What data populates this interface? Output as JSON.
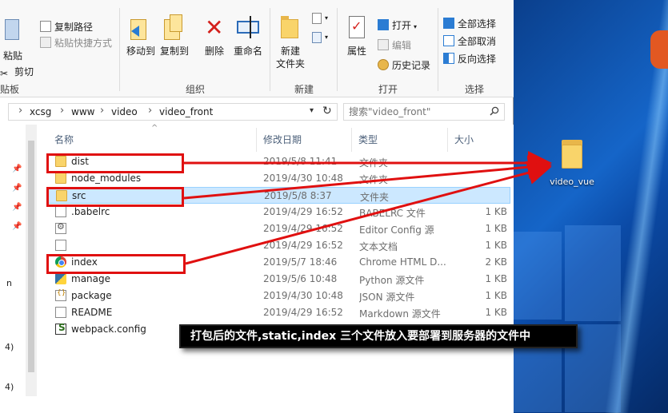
{
  "ribbon": {
    "clipboard": {
      "copy_path": "复制路径",
      "paste_shortcut": "粘贴快捷方式",
      "paste_partial": "粘贴",
      "cut": "剪切",
      "group_label_partial": "贴板"
    },
    "organize": {
      "move_to": "移动到",
      "copy_to": "复制到",
      "delete": "删除",
      "rename": "重命名",
      "group_label": "组织"
    },
    "new": {
      "new_folder_line1": "新建",
      "new_folder_line2": "文件夹",
      "group_label": "新建"
    },
    "open": {
      "properties": "属性",
      "open": "打开",
      "edit": "编辑",
      "history": "历史记录",
      "group_label": "打开"
    },
    "select": {
      "select_all": "全部选择",
      "select_none": "全部取消",
      "invert": "反向选择",
      "group_label": "选择"
    }
  },
  "address": {
    "crumbs": [
      "xcsg",
      "www",
      "video",
      "video_front"
    ],
    "search_placeholder": "搜索\"video_front\""
  },
  "nav": {
    "partial_texts": [
      "n",
      "4)",
      "4)"
    ]
  },
  "columns": {
    "name": "名称",
    "date": "修改日期",
    "type": "类型",
    "size": "大小"
  },
  "files": [
    {
      "name": "dist",
      "date": "2019/5/8 11:41",
      "type": "文件夹",
      "size": "",
      "icon": "folder-icon"
    },
    {
      "name": "node_modules",
      "date": "2019/4/30 10:48",
      "type": "文件夹",
      "size": "",
      "icon": "folder-icon"
    },
    {
      "name": "src",
      "date": "2019/5/8 8:37",
      "type": "文件夹",
      "size": "",
      "icon": "folder-icon"
    },
    {
      "name": ".babelrc",
      "date": "2019/4/29 16:52",
      "type": "BABELRC 文件",
      "size": "1 KB",
      "icon": "file-icon"
    },
    {
      "name": "",
      "date": "2019/4/29 16:52",
      "type": "Editor Config 源",
      "size": "1 KB",
      "icon": "config-file-icon"
    },
    {
      "name": "",
      "date": "2019/4/29 16:52",
      "type": "文本文档",
      "size": "1 KB",
      "icon": "text-file-icon"
    },
    {
      "name": "index",
      "date": "2019/5/7 18:46",
      "type": "Chrome HTML D...",
      "size": "2 KB",
      "icon": "chrome-icon"
    },
    {
      "name": "manage",
      "date": "2019/5/6 10:48",
      "type": "Python 源文件",
      "size": "1 KB",
      "icon": "python-icon"
    },
    {
      "name": "package",
      "date": "2019/4/30 10:48",
      "type": "JSON 源文件",
      "size": "1 KB",
      "icon": "json-icon"
    },
    {
      "name": "README",
      "date": "2019/4/29 16:52",
      "type": "Markdown 源文件",
      "size": "1 KB",
      "icon": "markdown-icon"
    },
    {
      "name": "webpack.config",
      "date": "",
      "type": "",
      "size": "",
      "icon": "webpack-icon"
    }
  ],
  "desktop": {
    "folder_label": "video_vue"
  },
  "annotation": {
    "caption": "打包后的文件,static,index 三个文件放入要部署到服务器的文件中",
    "box_color": "#e01010"
  }
}
